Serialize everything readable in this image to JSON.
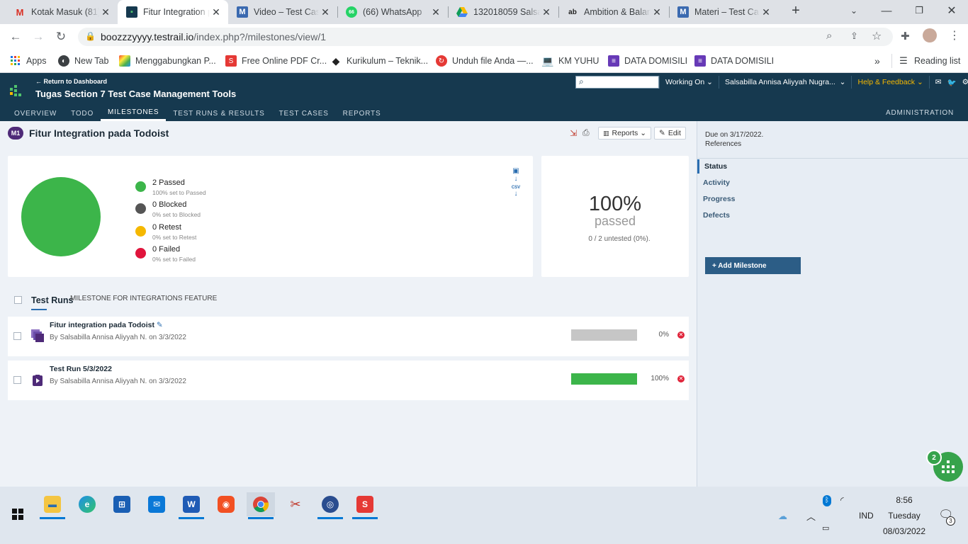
{
  "browser": {
    "tabs": [
      {
        "title": "Kotak Masuk (81)",
        "icon": "gmail-icon",
        "active": false
      },
      {
        "title": "Fitur Integration p",
        "icon": "testrail-icon",
        "active": true
      },
      {
        "title": "Video – Test Case",
        "icon": "moodle-icon",
        "active": false
      },
      {
        "title": "(66) WhatsApp",
        "icon": "whatsapp-icon",
        "active": false
      },
      {
        "title": "132018059 Salsab",
        "icon": "drive-icon",
        "active": false
      },
      {
        "title": "Ambition & Balan",
        "icon": "ab-icon",
        "active": false
      },
      {
        "title": "Materi – Test Cas",
        "icon": "moodle-icon",
        "active": false
      }
    ],
    "url": {
      "host": "boozzzyyyy.testrail.io",
      "path": "/index.php?/milestones/view/1"
    },
    "bookmarks": [
      {
        "label": "Apps",
        "icon": "apps-grid-icon"
      },
      {
        "label": "New Tab",
        "icon": "globe-icon"
      },
      {
        "label": "Menggabungkan P...",
        "icon": "colorful-icon"
      },
      {
        "label": "Free Online PDF Cr...",
        "icon": "s-red-icon"
      },
      {
        "label": "Kurikulum – Teknik...",
        "icon": "diamond-icon"
      },
      {
        "label": "Unduh file Anda —...",
        "icon": "refresh-red-icon"
      },
      {
        "label": "KM YUHU",
        "icon": "laptop-icon"
      },
      {
        "label": "DATA DOMISILI",
        "icon": "forms-icon"
      },
      {
        "label": "DATA DOMISILI",
        "icon": "forms-icon"
      }
    ],
    "reading_list": "Reading list"
  },
  "testrail": {
    "back_link": "← Return to Dashboard",
    "project": "Tugas Section 7 Test Case Management Tools",
    "working_on": "Working On",
    "user": "Salsabilla Annisa Aliyyah Nugra...",
    "help": "Help & Feedback",
    "nav": [
      "OVERVIEW",
      "TODO",
      "MILESTONES",
      "TEST RUNS & RESULTS",
      "TEST CASES",
      "REPORTS"
    ],
    "admin": "ADMINISTRATION",
    "colors": {
      "header": "#16394f",
      "passed": "#3cb54a",
      "blocked": "#555555",
      "retest": "#f5b800",
      "failed": "#e0143c",
      "accent": "#f5b800"
    }
  },
  "milestone": {
    "badge": "M1",
    "title": "Fitur Integration pada Todoist",
    "reports_label": "Reports",
    "edit_label": "Edit",
    "stats": [
      {
        "label": "2 Passed",
        "sub": "100% set to Passed"
      },
      {
        "label": "0 Blocked",
        "sub": "0% set to Blocked"
      },
      {
        "label": "0 Retest",
        "sub": "0% set to Retest"
      },
      {
        "label": "0 Failed",
        "sub": "0% set to Failed"
      }
    ],
    "percent": "100%",
    "percent_label": "passed",
    "untested": "0 / 2 untested (0%).",
    "test_runs_label": "Test Runs",
    "test_runs_desc": "MILESTONE FOR INTEGRATIONS FEATURE",
    "runs": [
      {
        "title": "Fitur integration pada Todoist",
        "by": "By Salsabilla Annisa Aliyyah N. on 3/3/2022",
        "percent": "0%",
        "progress": 0
      },
      {
        "title": "Test Run 5/3/2022",
        "by": "By Salsabilla Annisa Aliyyah N. on 3/3/2022",
        "percent": "100%",
        "progress": 1
      }
    ]
  },
  "sidebar": {
    "due": "Due on 3/17/2022.",
    "references": "References",
    "items": [
      "Status",
      "Activity",
      "Progress",
      "Defects"
    ],
    "add_button": "+ Add Milestone",
    "fab_badge": "2"
  },
  "taskbar": {
    "language": "IND",
    "time": "8:56",
    "day": "Tuesday",
    "date": "08/03/2022",
    "notifications": "3"
  }
}
